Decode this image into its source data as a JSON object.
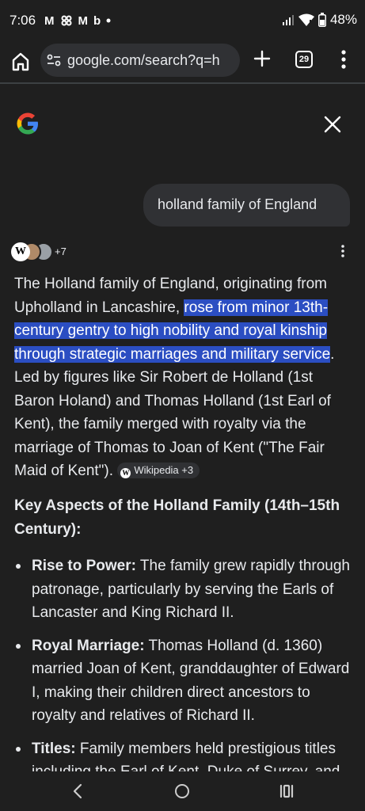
{
  "status_bar": {
    "time": "7:06",
    "notification_icons": [
      "gmail-icon",
      "slack-icon",
      "gmail-icon",
      "b-app-icon",
      "dot-icon"
    ],
    "battery": "48%"
  },
  "browser": {
    "url": "google.com/search?q=h",
    "tab_count": "29"
  },
  "search": {
    "query": "holland family of England"
  },
  "sources": {
    "more_label": "+7"
  },
  "answer": {
    "intro_before": "The Holland family of England, originating from Upholland in Lancashire, ",
    "intro_highlight": "rose from minor 13th-century gentry to high nobility and royal kinship through strategic marriages and military service",
    "intro_after": ". Led by figures like Sir Robert de Holland (1st Baron Holand) and Thomas Holland (1st Earl of Kent), the family merged with royalty via the marriage of Thomas to Joan of Kent (\"The Fair Maid of Kent\"). ",
    "citation_chip": "Wikipedia +3"
  },
  "section": {
    "heading": "Key Aspects of the Holland Family (14th–15th Century):"
  },
  "bullets": [
    {
      "title": "Rise to Power:",
      "text": " The family grew rapidly through patronage, particularly by serving the Earls of Lancaster and King Richard II."
    },
    {
      "title": "Royal Marriage:",
      "text": " Thomas Holland (d. 1360) married Joan of Kent, granddaughter of Edward I, making their children direct ancestors to royalty and relatives of Richard II."
    },
    {
      "title": "Titles:",
      "text": " Family members held prestigious titles including the Earl of Kent, Duke of Surrey, and"
    }
  ],
  "colors": {
    "background": "#1f1f1f",
    "bubble": "#303134",
    "highlight": "#2b4ec2",
    "text": "#e8eaed"
  }
}
